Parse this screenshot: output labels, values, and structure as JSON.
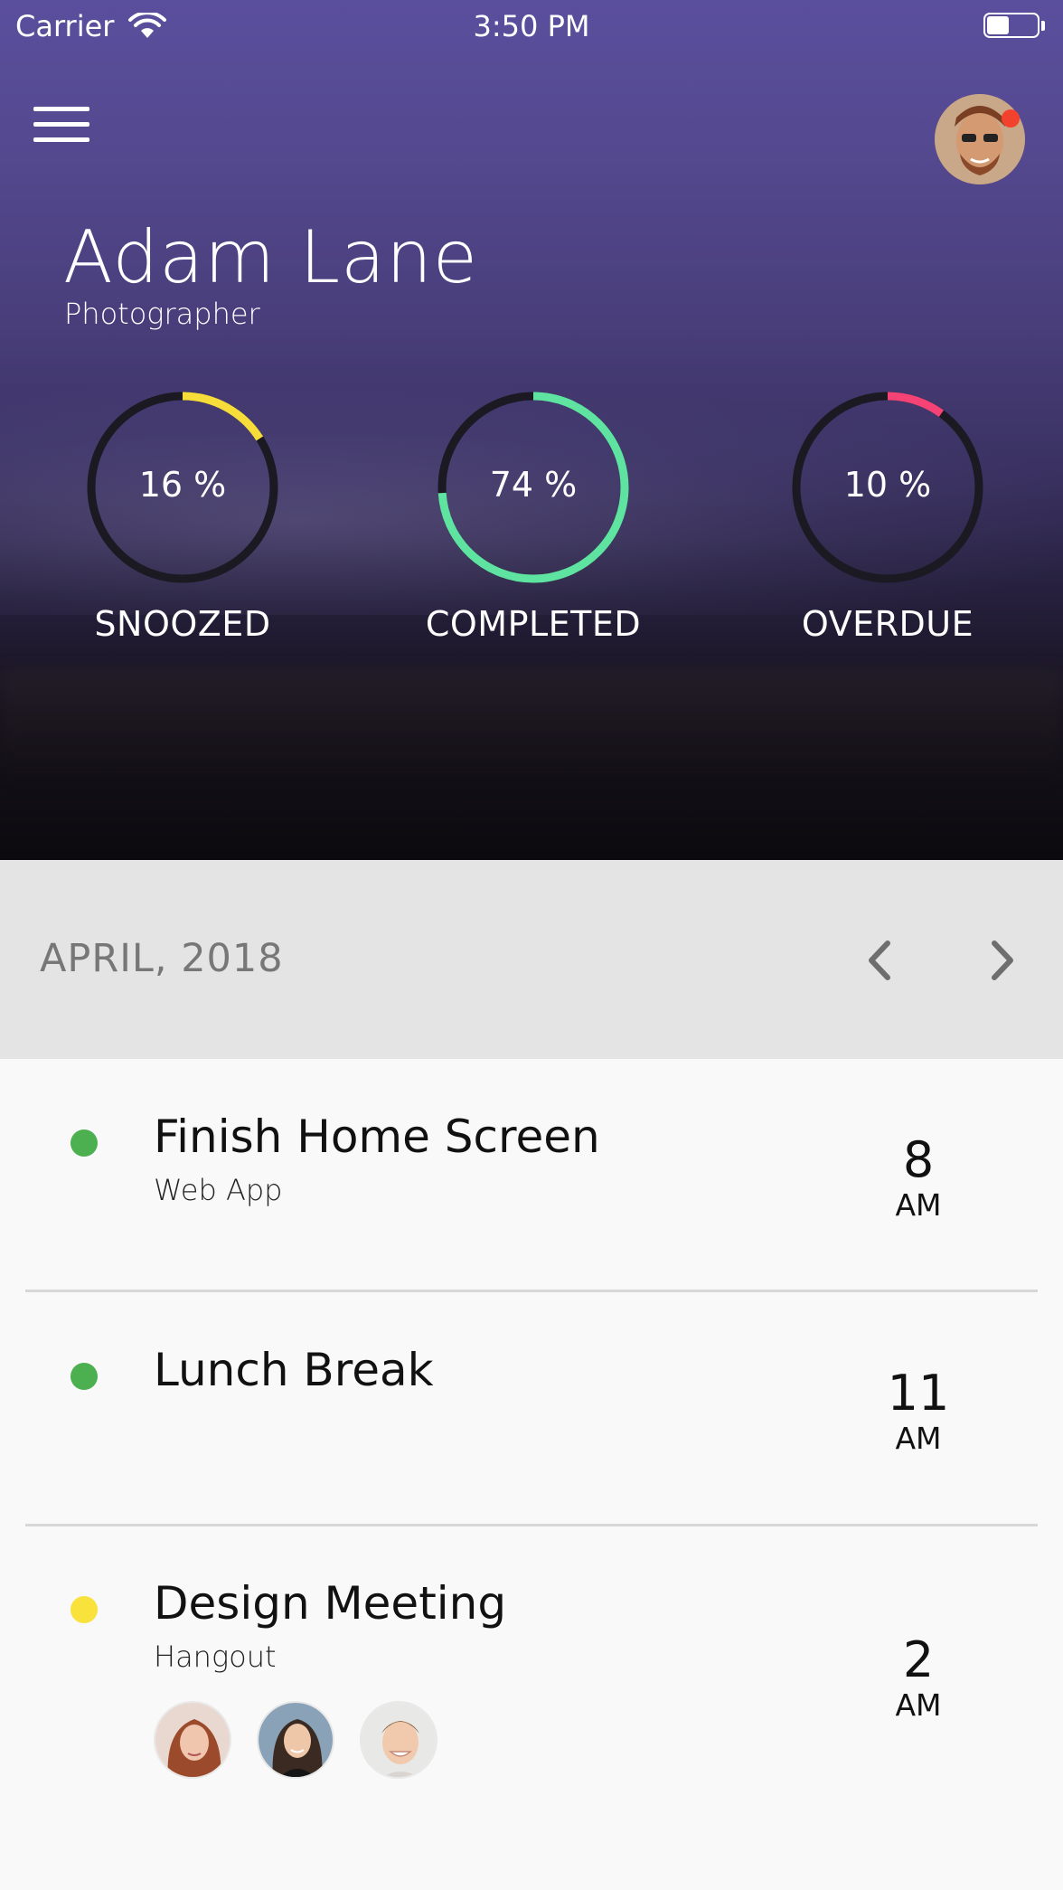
{
  "status_bar": {
    "carrier": "Carrier",
    "time": "3:50 PM"
  },
  "profile": {
    "name": "Adam Lane",
    "role": "Photographer"
  },
  "stats": [
    {
      "percent_label": "16 %",
      "label": "SNOOZED",
      "value": 0.16,
      "color": "#f6dd3a"
    },
    {
      "percent_label": "74 %",
      "label": "COMPLETED",
      "value": 0.74,
      "color": "#5fe3a1"
    },
    {
      "percent_label": "10 %",
      "label": "OVERDUE",
      "value": 0.1,
      "color": "#f54376"
    }
  ],
  "month": {
    "label": "APRIL, 2018"
  },
  "events": [
    {
      "title": "Finish Home Screen",
      "subtitle": "Web App",
      "hour": "8",
      "ampm": "AM",
      "status_color": "#4caf50"
    },
    {
      "title": "Lunch Break",
      "subtitle": "",
      "hour": "11",
      "ampm": "AM",
      "status_color": "#4caf50"
    },
    {
      "title": "Design Meeting",
      "subtitle": "Hangout",
      "hour": "2",
      "ampm": "AM",
      "status_color": "#f8e23b"
    }
  ],
  "icons": {
    "menu": "menu-icon",
    "wifi": "wifi-icon",
    "battery": "battery-icon",
    "prev": "chevron-left-icon",
    "next": "chevron-right-icon"
  },
  "colors": {
    "ring_track": "#1b1921",
    "month_bar_bg": "#e4e4e4",
    "list_bg": "#f9f9f9"
  }
}
